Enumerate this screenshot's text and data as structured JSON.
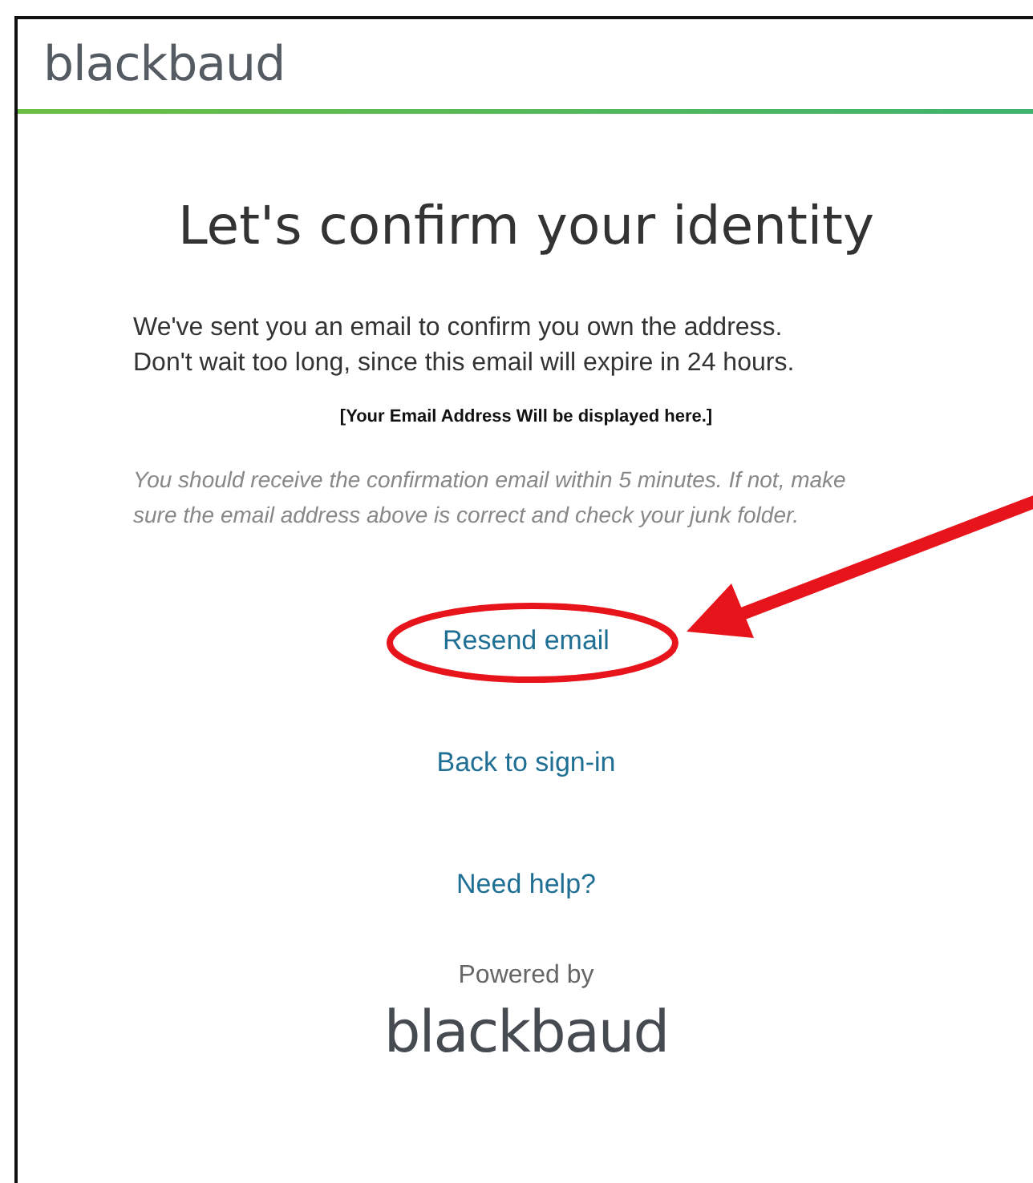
{
  "header": {
    "logo": "blackbaud"
  },
  "title": "Let's confirm your identity",
  "message": "We've sent you an email to confirm you own the address. Don't wait too long, since this email will expire in 24 hours.",
  "email_placeholder": "[Your Email Address Will be displayed here.]",
  "note": "You should receive the confirmation email within 5 minutes. If not, make sure the email address above is correct and check your junk folder.",
  "links": [
    {
      "label": "Resend email",
      "highlighted": true
    },
    {
      "label": "Back to sign-in",
      "highlighted": false
    },
    {
      "label": "Need help?",
      "highlighted": false
    }
  ],
  "footer": {
    "powered_by": "Powered by",
    "logo": "blackbaud"
  }
}
